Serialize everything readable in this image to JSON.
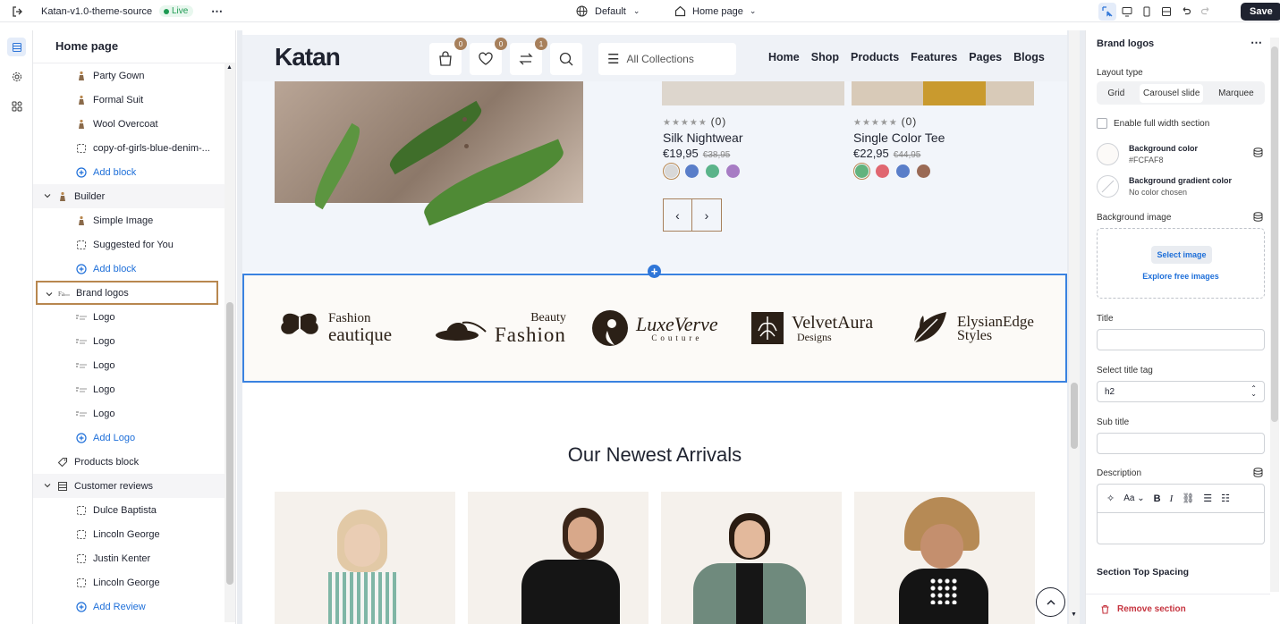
{
  "topbar": {
    "theme_name": "Katan-v1.0-theme-source",
    "status": "Live",
    "preset": "Default",
    "template": "Home page",
    "save": "Save"
  },
  "sidebar": {
    "title": "Home page",
    "items": [
      {
        "label": "Party Gown",
        "icon": "product-icon",
        "level": 2
      },
      {
        "label": "Formal Suit",
        "icon": "product-icon",
        "level": 2
      },
      {
        "label": "Wool Overcoat",
        "icon": "product-icon",
        "level": 2
      },
      {
        "label": "copy-of-girls-blue-denim-...",
        "icon": "dashed-square-icon",
        "level": 2
      },
      {
        "label": "Add block",
        "icon": "add-icon",
        "level": 2,
        "add": true
      },
      {
        "label": "Builder",
        "icon": "product-icon",
        "level": 1,
        "caret": true
      },
      {
        "label": "Simple Image",
        "icon": "product-icon",
        "level": 2
      },
      {
        "label": "Suggested for You",
        "icon": "dashed-square-icon",
        "level": 2
      },
      {
        "label": "Add block",
        "icon": "add-icon",
        "level": 2,
        "add": true
      },
      {
        "label": "Brand logos",
        "icon": "logos-icon",
        "level": 1,
        "caret": true,
        "selected": true
      },
      {
        "label": "Logo",
        "icon": "logo-thumb-icon",
        "level": 2
      },
      {
        "label": "Logo",
        "icon": "logo-thumb-icon",
        "level": 2
      },
      {
        "label": "Logo",
        "icon": "logo-thumb-icon",
        "level": 2
      },
      {
        "label": "Logo",
        "icon": "logo-thumb-icon",
        "level": 2
      },
      {
        "label": "Logo",
        "icon": "logo-thumb-icon",
        "level": 2
      },
      {
        "label": "Add Logo",
        "icon": "add-icon",
        "level": 2,
        "add": true
      },
      {
        "label": "Products block",
        "icon": "tag-icon",
        "level": 1
      },
      {
        "label": "Customer reviews",
        "icon": "list-icon",
        "level": 1,
        "caret": true
      },
      {
        "label": "Dulce Baptista",
        "icon": "dashed-square-icon",
        "level": 2
      },
      {
        "label": "Lincoln George",
        "icon": "dashed-square-icon",
        "level": 2
      },
      {
        "label": "Justin Kenter",
        "icon": "dashed-square-icon",
        "level": 2
      },
      {
        "label": "Lincoln George",
        "icon": "dashed-square-icon",
        "level": 2
      },
      {
        "label": "Add Review",
        "icon": "add-icon",
        "level": 2,
        "add": true
      }
    ]
  },
  "preview": {
    "logo": "Katan",
    "cart_count": "0",
    "wishlist_count": "0",
    "compare_count": "1",
    "collections": "All Collections",
    "nav": [
      "Home",
      "Shop",
      "Products",
      "Features",
      "Pages",
      "Blogs"
    ],
    "products": [
      {
        "rating": "★★★★★",
        "reviews": "(0)",
        "name": "Silk Nightwear",
        "price": "€19,95",
        "old": "€38,95",
        "swatches": [
          "#d8d8d8",
          "#5a7ec9",
          "#5bb48a",
          "#a77cc4"
        ]
      },
      {
        "rating": "★★★★★",
        "reviews": "(0)",
        "name": "Single Color Tee",
        "price": "€22,95",
        "old": "€44,95",
        "swatches": [
          "#62b37e",
          "#e06670",
          "#5a7ec9",
          "#9a6a55"
        ]
      }
    ],
    "brands": [
      {
        "line1": "Fashion",
        "line2": "eautique"
      },
      {
        "line1": "Beauty",
        "line2": "Fashion"
      },
      {
        "line1": "LuxeVerve",
        "line2": "Couture"
      },
      {
        "line1": "VelvetAura",
        "line2": "Designs"
      },
      {
        "line1": "ElysianEdge",
        "line2": "Styles"
      }
    ],
    "arrivals_title": "Our Newest Arrivals"
  },
  "settings": {
    "title": "Brand logos",
    "layout_label": "Layout type",
    "layout_options": [
      "Grid",
      "Carousel slide",
      "Marquee"
    ],
    "layout_selected": "Carousel slide",
    "full_width": "Enable full width section",
    "bg_color_label": "Background color",
    "bg_color_value": "#FCFAF8",
    "bg_gradient_label": "Background gradient color",
    "bg_gradient_value": "No color chosen",
    "bg_image_label": "Background image",
    "select_image": "Select image",
    "explore": "Explore free images",
    "title_label": "Title",
    "title_tag_label": "Select title tag",
    "title_tag_value": "h2",
    "subtitle_label": "Sub title",
    "description_label": "Description",
    "top_spacing": "Section Top Spacing",
    "remove": "Remove section"
  },
  "colors": {
    "accent": "#2f76d8",
    "brand_brown": "#a7805c",
    "selected_outline": "#b8874f",
    "bg_color": "#FCFAF8"
  }
}
